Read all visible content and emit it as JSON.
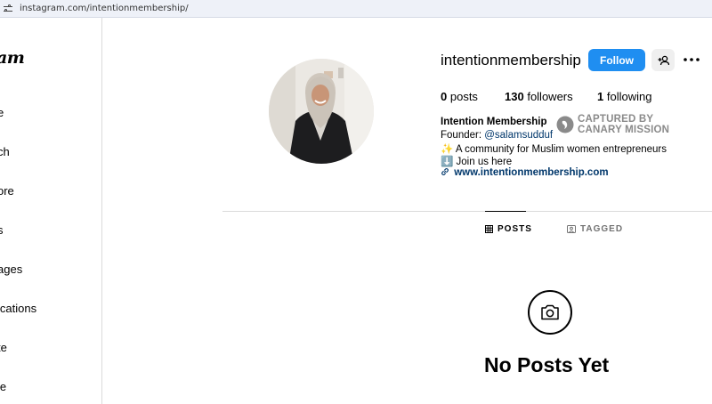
{
  "browser": {
    "url": "instagram.com/intentionmembership/",
    "url_icon": "tune-icon"
  },
  "sidebar": {
    "logo_partial": "am",
    "items": [
      {
        "label": "e",
        "icon": "home-icon"
      },
      {
        "label": "ch",
        "icon": "search-icon"
      },
      {
        "label": "ore",
        "icon": "explore-icon"
      },
      {
        "label": "s",
        "icon": "reels-icon"
      },
      {
        "label": "ages",
        "icon": "messages-icon"
      },
      {
        "label": "ications",
        "icon": "notifications-icon"
      },
      {
        "label": "te",
        "icon": "create-icon"
      },
      {
        "label": "le",
        "icon": "profile-icon"
      }
    ]
  },
  "profile": {
    "username": "intentionmembership",
    "follow_label": "Follow",
    "stats": [
      {
        "value": "0",
        "label": "posts"
      },
      {
        "value": "130",
        "label": "followers"
      },
      {
        "value": "1",
        "label": "following"
      }
    ],
    "display_name": "Intention Membership",
    "founder_prefix": "Founder: ",
    "founder_mention": "@salamsudduf",
    "bio_lines": [
      {
        "emoji": "✨",
        "text": "A community for Muslim women entrepreneurs"
      },
      {
        "emoji": "⬇️",
        "text": "Join us here"
      }
    ],
    "link": "www.intentionmembership.com"
  },
  "watermark": {
    "line1": "CAPTURED BY",
    "line2": "CANARY MISSION"
  },
  "tabs": [
    {
      "label": "POSTS",
      "icon": "grid-icon",
      "active": true
    },
    {
      "label": "TAGGED",
      "icon": "tagged-icon",
      "active": false
    }
  ],
  "empty_state": {
    "title": "No Posts Yet",
    "icon": "camera-icon"
  },
  "colors": {
    "accent": "#1f8ef1",
    "link": "#00376b",
    "border": "#dbdbdb"
  }
}
